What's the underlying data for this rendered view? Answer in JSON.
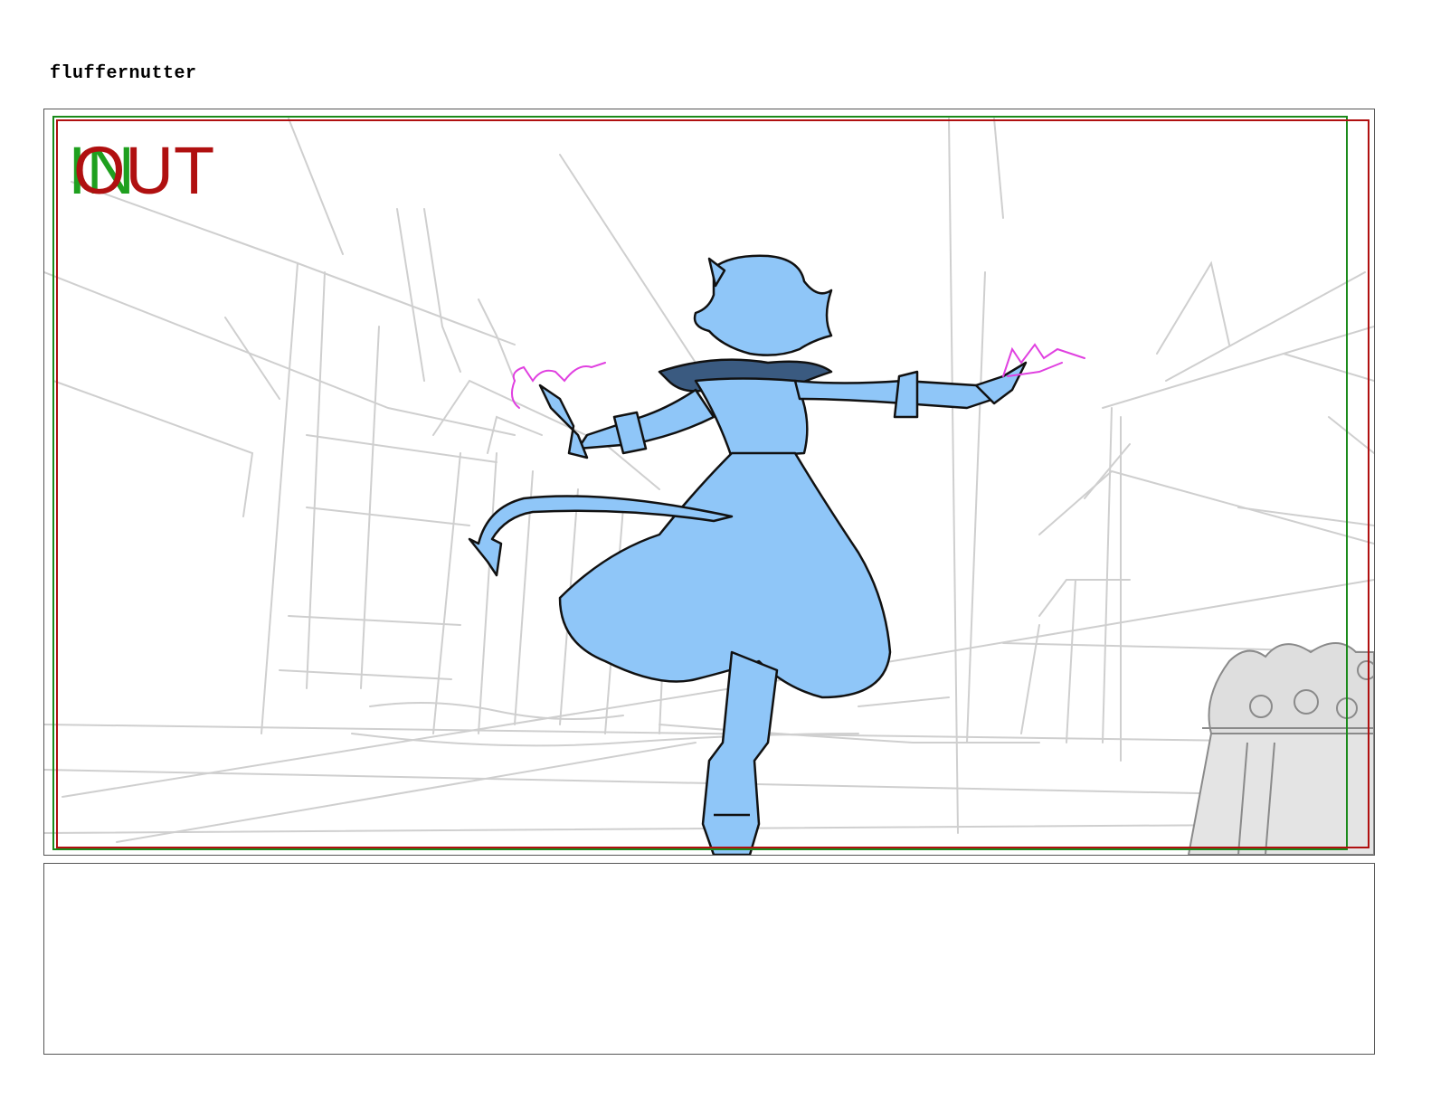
{
  "board": {
    "project_title": "fluffernutter"
  },
  "panel": {
    "marker_in": "IN",
    "marker_out": "OUT",
    "safe_frame_in_color": "#1a8a1a",
    "safe_frame_out_color": "#b01010",
    "fill_color": "#8fc6f8",
    "magic_color": "#e040e0",
    "background_line_color": "#c8c8c8"
  },
  "notes": {
    "text": ""
  }
}
